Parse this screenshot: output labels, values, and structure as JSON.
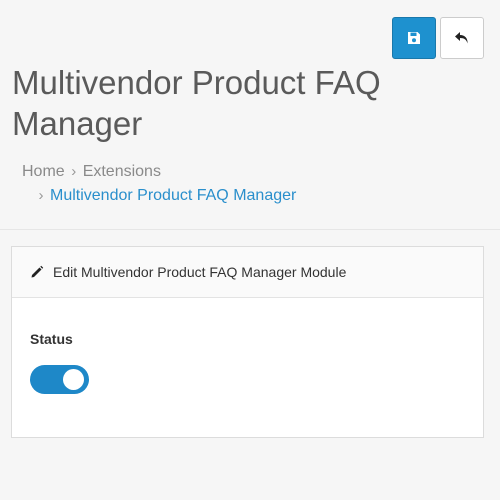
{
  "header": {
    "title": "Multivendor Product FAQ Manager",
    "save_icon": "save-icon",
    "back_icon": "undo-arrow-icon"
  },
  "breadcrumb": {
    "items": [
      "Home",
      "Extensions",
      "Multivendor Product FAQ Manager"
    ]
  },
  "panel": {
    "heading": "Edit Multivendor Product FAQ Manager Module",
    "heading_icon": "pencil-icon",
    "status_label": "Status",
    "status_enabled": true
  },
  "colors": {
    "accent": "#1e91cf",
    "link": "#2a8fcc"
  }
}
